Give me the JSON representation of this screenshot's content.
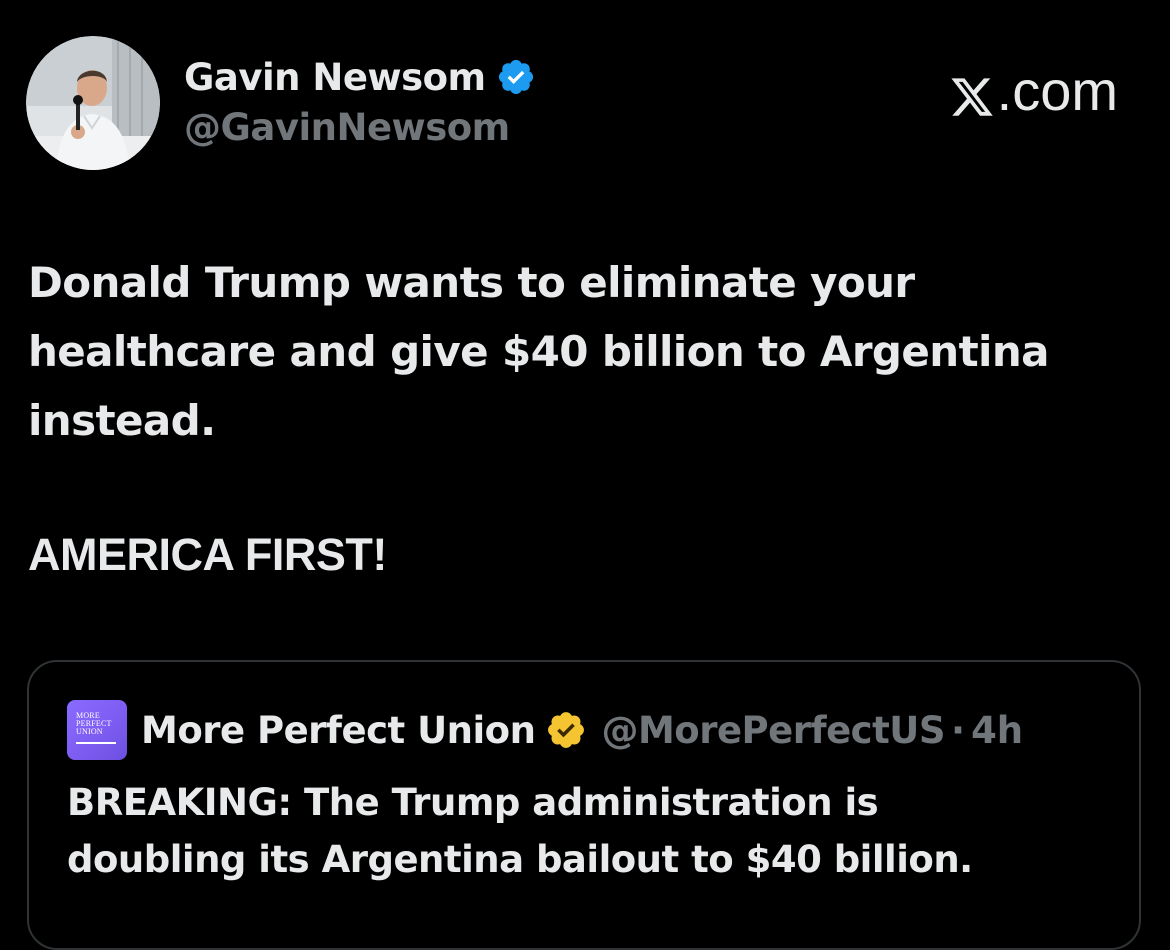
{
  "brand": {
    "logo_icon": "x-logo-icon",
    "domain_text": ".com"
  },
  "author": {
    "name": "Gavin Newsom",
    "handle": "@GavinNewsom",
    "verified_badge": "blue-verified-icon",
    "verified_color": "#1d9bf0"
  },
  "post": {
    "text_lines": [
      "Donald Trump wants to eliminate your",
      "healthcare and give $40 billion to Argentina",
      "instead."
    ],
    "slogan": "AMERICA FIRST!"
  },
  "quoted_post": {
    "avatar_text": [
      "MORE",
      "PERFECT",
      "UNION"
    ],
    "name": "More Perfect Union",
    "verified_badge": "gold-verified-icon",
    "verified_color": "#f4c431",
    "handle": "@MorePerfectUS",
    "separator": "·",
    "time": "4h",
    "text_lines": [
      "BREAKING: The Trump administration is",
      "doubling its Argentina bailout to $40 billion."
    ]
  },
  "colors": {
    "background": "#000000",
    "primary_text": "#e7e9ea",
    "secondary_text": "#71767b",
    "border": "#2f3336",
    "quote_avatar": "#7c5cf0"
  }
}
